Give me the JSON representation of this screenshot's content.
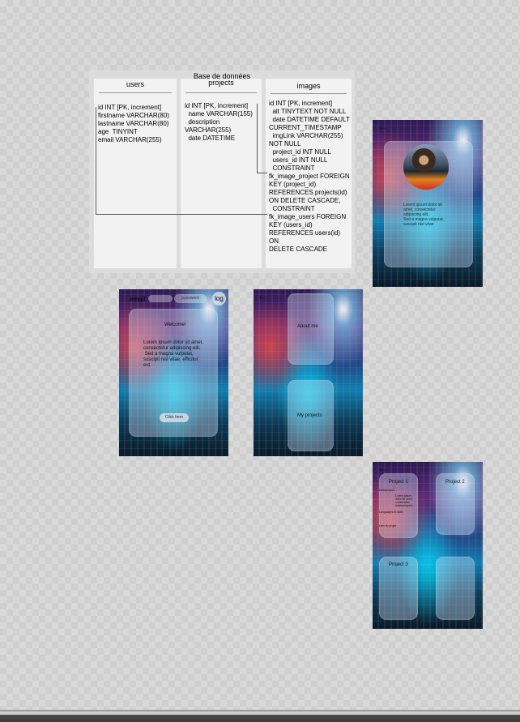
{
  "diagram": {
    "title": "Base de données",
    "tables": [
      {
        "name": "users",
        "fields": "id INT [PK, increment]\nfirstname VARCHAR(80)\nlastname VARCHAR(80)\nage  TINYINT\nemail VARCHAR(255)"
      },
      {
        "name": "projects",
        "fields": "id INT [PK, increment]\n  name VARCHAR(155)\n  description\nVARCHAR(255)\n  date DATETIME"
      },
      {
        "name": "images",
        "fields": "id INT [PK, increment]\n  alt TINYTEXT NOT NULL\n  date DATETIME DEFAULT\nCURRENT_TIMESTAMP\n  imgLink VARCHAR(255)\nNOT NULL\n  project_id INT NULL\n  users_id INT NULL\n  CONSTRAINT\nfk_image_project FOREIGN\nKEY (project_id)\nREFERENCES projects(id)\nON DELETE CASCADE,\n  CONSTRAINT\nfk_image_users FOREIGN\nKEY (users_id)\nREFERENCES users(id) ON\nDELETE CASCADE"
      }
    ]
  },
  "screens": {
    "profile": {
      "back": "←",
      "avatar_alt": "profile picture",
      "lorem": "Lorem ipsum dolor sit\namet, consectetur\nadipiscing elit.\nSed a magna vulputat,\nsuscipit nisl vitae"
    },
    "login": {
      "email_label": "email",
      "password_label": "password",
      "log_button": "log",
      "welcome": "Welcome!",
      "lorem": "Lorem ipsum dolor sit amet,\nconsectetur adipiscing elit.\n Sed a magna vulputat,\nsuscipit nisl vitae, efficitur\nest.",
      "click_button": "Click here"
    },
    "menu": {
      "back": "←",
      "about": "About me",
      "projects": "My projects"
    },
    "projects": {
      "back": "←",
      "project1": "Project 1",
      "project2": "Project 2",
      "project3": "Project 3",
      "p1_detail": "Lorem ipsum\ndolor sit amet,\nconsectetur\nadipiscing elit.",
      "p1_label_a": "Date/project",
      "p1_label_b": "Languages et skills",
      "p1_label_c": "Lien du projet"
    }
  },
  "colors": {
    "diagram_bg": "#dcdcdc",
    "column_bg": "#f2f2f2",
    "card": "rgba(210,225,245,0.38)"
  }
}
